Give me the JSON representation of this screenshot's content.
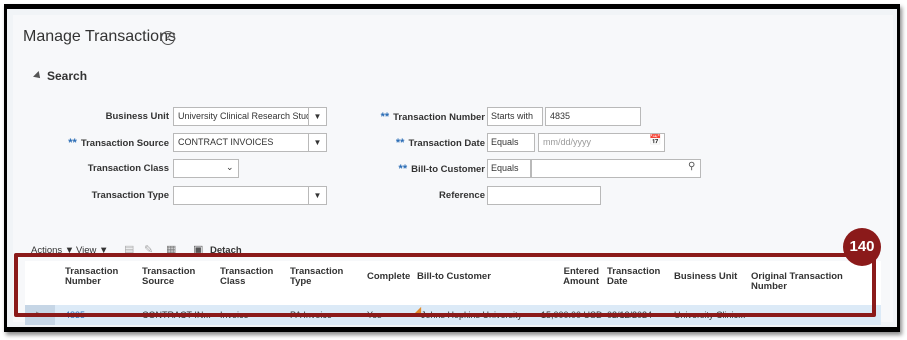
{
  "page": {
    "title": "Manage Transactions"
  },
  "search": {
    "header": "Search",
    "business_unit": {
      "label": "Business Unit",
      "value": "University Clinical Research Studi"
    },
    "transaction_source": {
      "label": "Transaction Source",
      "value": "CONTRACT INVOICES"
    },
    "transaction_class": {
      "label": "Transaction Class",
      "value": ""
    },
    "transaction_type": {
      "label": "Transaction Type",
      "value": ""
    },
    "transaction_number": {
      "label": "Transaction Number",
      "operator": "Starts with",
      "value": "4835"
    },
    "transaction_date": {
      "label": "Transaction Date",
      "operator": "Equals",
      "placeholder": "mm/dd/yyyy"
    },
    "bill_to_customer": {
      "label": "Bill-to Customer",
      "operator": "Equals",
      "value": ""
    },
    "reference": {
      "label": "Reference",
      "value": ""
    },
    "required_marker": "**"
  },
  "toolbar": {
    "actions": "Actions",
    "view": "View",
    "detach": "Detach"
  },
  "badge": "140",
  "table": {
    "headers": {
      "number": [
        "Transaction",
        "Number"
      ],
      "source": [
        "Transaction",
        "Source"
      ],
      "class": [
        "Transaction",
        "Class"
      ],
      "type": [
        "Transaction",
        "Type"
      ],
      "complete": "Complete",
      "customer": "Bill-to Customer",
      "amount": [
        "Entered",
        "Amount"
      ],
      "date": [
        "Transaction",
        "Date"
      ],
      "bu": "Business Unit",
      "original": "Original Transaction Number"
    },
    "rows": [
      {
        "number": "4835",
        "source": "CONTRACT IN...",
        "class": "Invoice",
        "type": "PA Invoice",
        "complete": "Yes",
        "customer": "Johns Hopkins University",
        "amount": "15,000.00 USD",
        "date": "02/12/2024",
        "bu": "University Clinic..."
      }
    ]
  },
  "colors": {
    "accent_outline": "#8b1a1a",
    "link": "#2a6cb5",
    "row_selected": "#dceaf7"
  }
}
